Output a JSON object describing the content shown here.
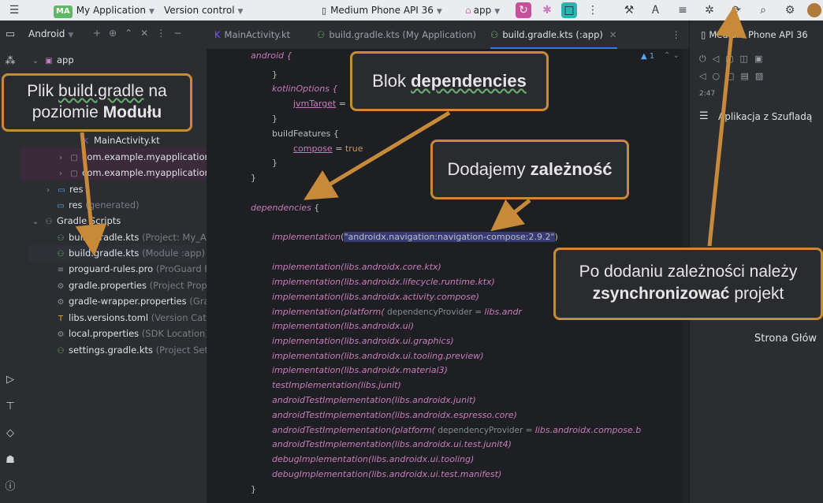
{
  "topbar": {
    "project_badge": "MA",
    "project_name": "My Application",
    "vcs": "Version control",
    "device": "Medium Phone API 36",
    "run_config": "app"
  },
  "tabs": [
    {
      "label": "MainActivity.kt"
    },
    {
      "label": "build.gradle.kts (My Application)"
    },
    {
      "label": "build.gradle.kts (:app)"
    }
  ],
  "project_panel": {
    "title": "Android",
    "tree": {
      "app": "app",
      "main_activity": "MainActivity.kt",
      "pkg1": "com.example.myapplication",
      "pkg2": "com.example.myapplication",
      "res": "res",
      "res_gen": "res",
      "res_gen_hint": "(generated)",
      "gradle_scripts": "Gradle Scripts",
      "build1": "build.gradle.kts",
      "build1_hint": "(Project: My_App",
      "build2": "build.gradle.kts",
      "build2_hint": "(Module :app)",
      "proguard": "proguard-rules.pro",
      "proguard_hint": "(ProGuard Ru",
      "gradle_props": "gradle.properties",
      "gradle_props_hint": "(Project Proper",
      "wrapper_props": "gradle-wrapper.properties",
      "wrapper_props_hint": "(Grad",
      "versions": "libs.versions.toml",
      "versions_hint": "(Version Catalo",
      "local_props": "local.properties",
      "local_props_hint": "(SDK Location)",
      "settings": "settings.gradle.kts",
      "settings_hint": "(Project Settin"
    }
  },
  "editor": {
    "warning_count": "1",
    "lines": {
      "l1": "android {",
      "l2": "}",
      "l3a": "kotlinOptions {",
      "l4a": "jvmTarget",
      "l4b": " = ",
      "l5": "}",
      "l6a": "buildFeatures {",
      "l7a": "compose",
      "l7b": " = ",
      "l7c": "true",
      "l8": "}",
      "l9": "}",
      "l10a": "dependencies",
      "l10b": " {",
      "dep_impl": "implementation",
      "dep_str": "\"androidx.navigation:navigation-compose:2.9.2\"",
      "i1": "implementation(libs.androidx.core.ktx)",
      "i2": "implementation(libs.androidx.lifecycle.runtime.ktx)",
      "i3": "implementation(libs.androidx.activity.compose)",
      "i4a": "implementation(platform(",
      "i4b": " dependencyProvider = ",
      "i4c": "libs.andr",
      "i5": "implementation(libs.androidx.ui)",
      "i6": "implementation(libs.androidx.ui.graphics)",
      "i7": "implementation(libs.androidx.ui.tooling.preview)",
      "i8": "implementation(libs.androidx.material3)",
      "i9": "testImplementation(libs.junit)",
      "i10": "androidTestImplementation(libs.androidx.junit)",
      "i11": "androidTestImplementation(libs.androidx.espresso.core)",
      "i12a": "androidTestImplementation(platform(",
      "i12b": " dependencyProvider = ",
      "i12c": "libs.androidx.compose.b",
      "i13": "androidTestImplementation(libs.androidx.ui.test.junit4)",
      "i14": "debugImplementation(libs.androidx.ui.tooling)",
      "i15": "debugImplementation(libs.androidx.ui.test.manifest)",
      "close": "}"
    }
  },
  "device_panel": {
    "title": "Medium Phone API 36",
    "time": "2:47",
    "app_title": "Aplikacja z Szufladą",
    "screen_text": "Strona Głów"
  },
  "callouts": {
    "c1_pre": "Plik ",
    "c1_link": "build.gradle",
    "c1_mid": " na",
    "c1_line2a": "poziomie ",
    "c1_line2b": "Modułu",
    "c2_pre": "Blok ",
    "c2_bold": "dependencies",
    "c3_pre": "Dodajemy ",
    "c3_bold": "zależność",
    "c4_line1": "Po dodaniu zależności należy",
    "c4_bold": "zsynchronizować",
    "c4_post": " projekt"
  },
  "colors": {
    "accent": "#c68a3a",
    "callout_bg": "#2a2b2e",
    "editor_bg": "#1e1f22",
    "panel_bg": "#2b2d30"
  }
}
